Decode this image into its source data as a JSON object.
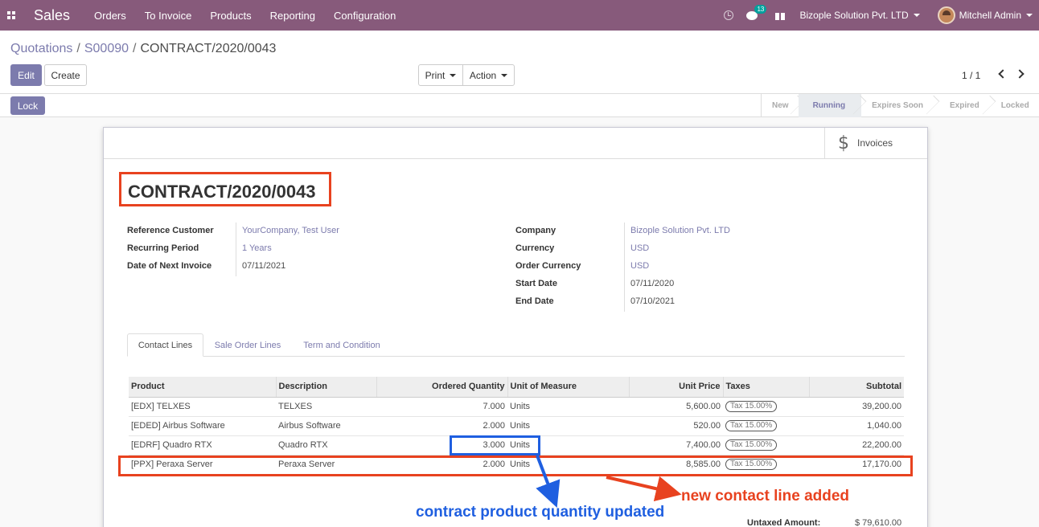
{
  "navbar": {
    "app_name": "Sales",
    "menu": [
      "Orders",
      "To Invoice",
      "Products",
      "Reporting",
      "Configuration"
    ],
    "message_count": "13",
    "company": "Bizople Solution Pvt. LTD",
    "user": "Mitchell Admin",
    "bg_color": "#875a7b"
  },
  "breadcrumb": {
    "items": [
      "Quotations",
      "S00090"
    ],
    "current": "CONTRACT/2020/0043"
  },
  "buttons": {
    "edit": "Edit",
    "create": "Create",
    "print": "Print",
    "action": "Action",
    "lock": "Lock"
  },
  "pager": {
    "value": "1 / 1"
  },
  "status": {
    "steps": [
      "New",
      "Running",
      "Expires Soon",
      "Expired",
      "Locked"
    ],
    "current": "Running"
  },
  "smart_button": {
    "icon": "dollar-icon",
    "label": "Invoices"
  },
  "form": {
    "title": "CONTRACT/2020/0043",
    "left_fields": [
      {
        "label": "Reference Customer",
        "value": "YourCompany, Test User",
        "is_link": true
      },
      {
        "label": "Recurring Period",
        "value": "1 Years",
        "is_link": true
      },
      {
        "label": "Date of Next Invoice",
        "value": "07/11/2021",
        "is_link": false
      }
    ],
    "right_fields": [
      {
        "label": "Company",
        "value": "Bizople Solution Pvt. LTD",
        "is_link": true
      },
      {
        "label": "Currency",
        "value": "USD",
        "is_link": true
      },
      {
        "label": "Order Currency",
        "value": "USD",
        "is_link": true
      },
      {
        "label": "Start Date",
        "value": "07/11/2020",
        "is_link": false
      },
      {
        "label": "End Date",
        "value": "07/10/2021",
        "is_link": false
      }
    ]
  },
  "tabs": [
    "Contact Lines",
    "Sale Order Lines",
    "Term and Condition"
  ],
  "active_tab": "Contact Lines",
  "table": {
    "columns": [
      "Product",
      "Description",
      "Ordered Quantity",
      "Unit of Measure",
      "Unit Price",
      "Taxes",
      "Subtotal"
    ],
    "rows": [
      {
        "product": "[EDX] TELXES",
        "description": "TELXES",
        "qty": "7.000",
        "uom": "Units",
        "price": "5,600.00",
        "tax": "Tax 15.00%",
        "subtotal": "39,200.00"
      },
      {
        "product": "[EDED] Airbus Software",
        "description": "Airbus Software",
        "qty": "2.000",
        "uom": "Units",
        "price": "520.00",
        "tax": "Tax 15.00%",
        "subtotal": "1,040.00"
      },
      {
        "product": "[EDRF] Quadro RTX",
        "description": "Quadro RTX",
        "qty": "3.000",
        "uom": "Units",
        "price": "7,400.00",
        "tax": "Tax 15.00%",
        "subtotal": "22,200.00"
      },
      {
        "product": "[PPX] Peraxa Server",
        "description": "Peraxa Server",
        "qty": "2.000",
        "uom": "Units",
        "price": "8,585.00",
        "tax": "Tax 15.00%",
        "subtotal": "17,170.00"
      }
    ]
  },
  "totals": {
    "untaxed_label": "Untaxed Amount:",
    "untaxed_value": "$ 79,610.00"
  },
  "annotations": {
    "new_line": "new contact line added",
    "qty_updated": "contract product quantity updated",
    "red_color": "#e8421f",
    "blue_color": "#1f5fe0"
  }
}
